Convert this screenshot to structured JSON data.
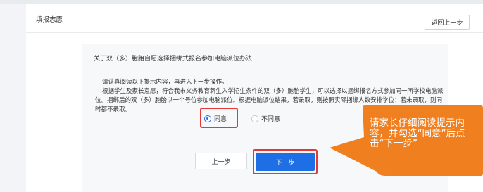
{
  "header": {
    "title": "填报志愿",
    "back_label": "返回上一步"
  },
  "doc": {
    "title": "关于双（多）胞胎自愿选择捆绑式报名参加电脑派位办法",
    "intro": "请认真阅读以下提示内容，再进入下一步操作。",
    "body": "根据学生及家长意愿，符合我市义务教育新生入学招生条件的双（多）胞胎学生，可以选择以捆绑报名方式参加同一所学校电脑派位。捆绑后的双（多）胞胎以一个号位参加电脑派位。根据电脑派位结果，若录取，则按照实际捆绑人数安排学位；若未录取，则同时都不录取。"
  },
  "choice": {
    "agree_label": "同意",
    "disagree_label": "不同意",
    "selected": "agree"
  },
  "actions": {
    "prev_label": "上一步",
    "next_label": "下一步"
  },
  "callout": {
    "text": "请家长仔细阅读提示内容，并勾选“同意”后点击“下一步”",
    "color": "#f07f1f"
  },
  "colors": {
    "primary": "#1e6fe6",
    "highlight": "#e53935"
  }
}
